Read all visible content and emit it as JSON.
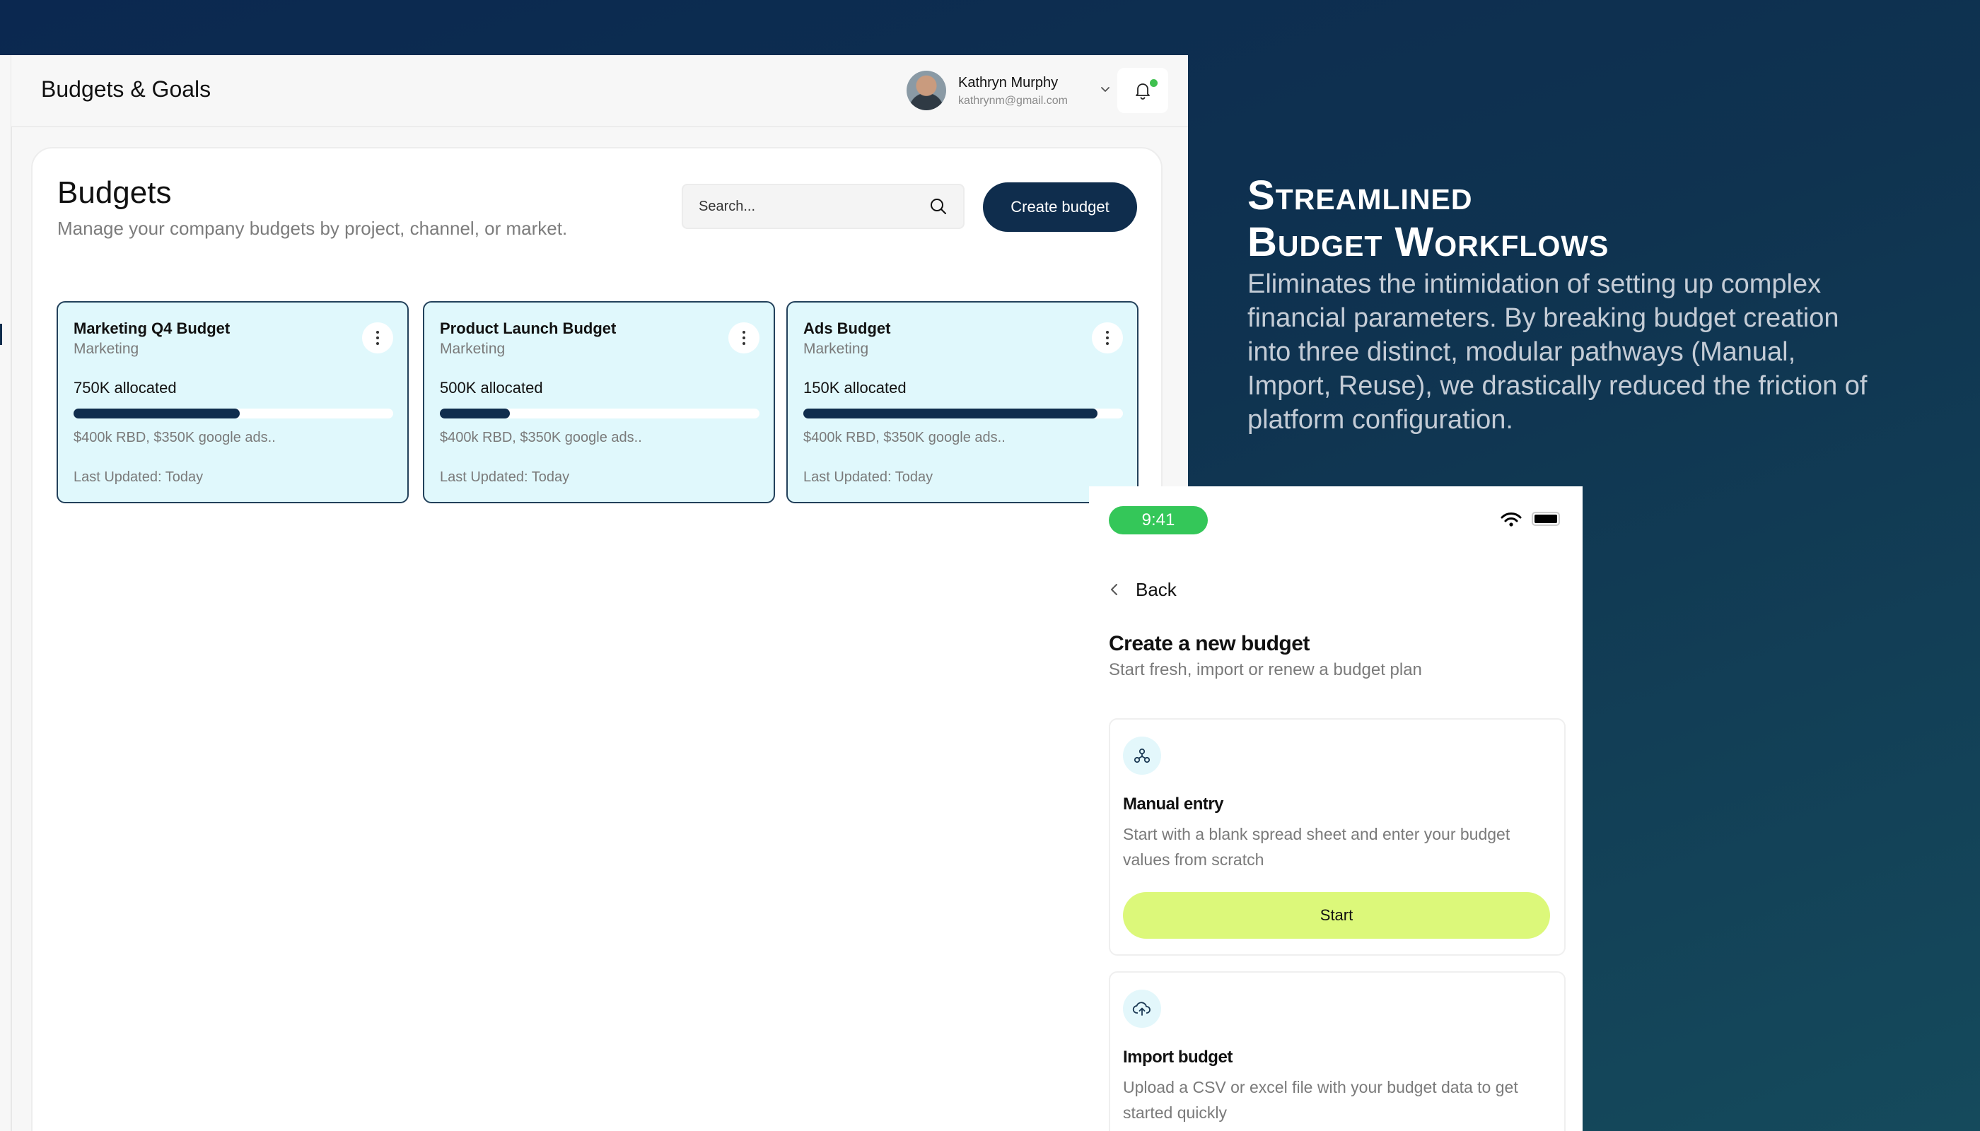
{
  "header": {
    "app_title": "Budgets & Goals",
    "user_name": "Kathryn Murphy",
    "user_email": "kathrynm@gmail.com"
  },
  "budgets": {
    "title": "Budgets",
    "subtitle": "Manage your company budgets by project, channel, or market.",
    "search_placeholder": "Search...",
    "create_label": "Create budget",
    "cards": [
      {
        "name": "Marketing Q4 Budget",
        "category": "Marketing",
        "allocated": "750K allocated",
        "progress": 0.52,
        "details": "$400k RBD, $350K google ads..",
        "updated": "Last Updated: Today"
      },
      {
        "name": "Product Launch Budget",
        "category": "Marketing",
        "allocated": "500K allocated",
        "progress": 0.22,
        "details": "$400k RBD, $350K google ads..",
        "updated": "Last Updated: Today"
      },
      {
        "name": "Ads Budget",
        "category": "Marketing",
        "allocated": "150K allocated",
        "progress": 0.92,
        "details": "$400k RBD, $350K google ads..",
        "updated": "Last Updated: Today"
      }
    ]
  },
  "headline": {
    "line1": "Streamlined",
    "line2": "Budget Workflows",
    "description": "Eliminates the intimidation of setting up complex financial parameters. By breaking budget creation into three distinct, modular pathways (Manual, Import, Reuse), we drastically reduced the friction of platform configuration."
  },
  "mobile": {
    "time": "9:41",
    "back_label": "Back",
    "title": "Create a new budget",
    "subtitle": "Start fresh, import or renew a budget plan",
    "options": [
      {
        "title": "Manual entry",
        "description": "Start with a blank spread sheet and enter your budget values from scratch",
        "button": "Start",
        "icon": "nodes-icon"
      },
      {
        "title": "Import budget",
        "description": "Upload a CSV or excel file with your budget data to get started quickly",
        "icon": "cloud-upload-icon"
      }
    ]
  },
  "colors": {
    "background": "#0f3350",
    "brand_dark": "#0f2d4d",
    "card_bg": "#e0f8fc",
    "accent_lime": "#dcf87a",
    "status_green": "#34c759"
  }
}
